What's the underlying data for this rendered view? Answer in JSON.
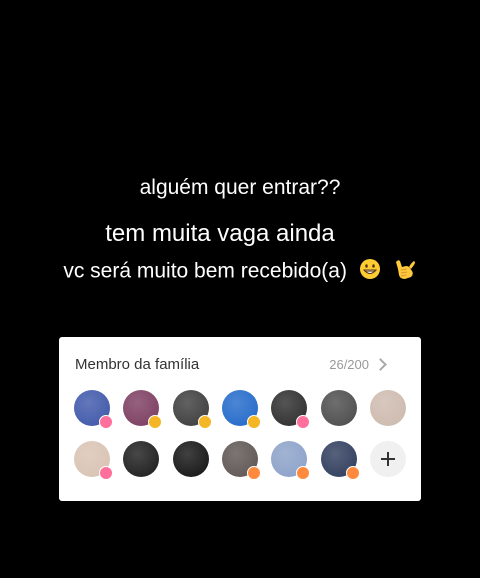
{
  "captions": {
    "line1": "alguém quer entrar??",
    "line2": "tem muita vaga ainda",
    "line3": "vc será muito bem recebido(a)",
    "emojis": [
      "grinning-face-icon",
      "call-me-hand-icon"
    ]
  },
  "family_card": {
    "title": "Membro da família",
    "count": "26/200",
    "members_row1": [
      {
        "name": "member-avatar-1",
        "color": "#3c55a8",
        "badge": "pink"
      },
      {
        "name": "member-avatar-2",
        "color": "#7a3a5e",
        "badge": "gold"
      },
      {
        "name": "member-avatar-3",
        "color": "#3a3a3a",
        "badge": "gold"
      },
      {
        "name": "member-avatar-4",
        "color": "#1f67c9",
        "badge": "gold"
      },
      {
        "name": "member-avatar-5",
        "color": "#2a2a2a",
        "badge": "pink"
      },
      {
        "name": "member-avatar-6",
        "color": "#4a4a4a",
        "badge": "none"
      },
      {
        "name": "member-avatar-7",
        "color": "#cdb9ad",
        "badge": "none"
      }
    ],
    "members_row2": [
      {
        "name": "member-avatar-8",
        "color": "#d8c2b2",
        "badge": "pink"
      },
      {
        "name": "member-avatar-9",
        "color": "#1a1a1a",
        "badge": "none"
      },
      {
        "name": "member-avatar-10",
        "color": "#111111",
        "badge": "none"
      },
      {
        "name": "member-avatar-11",
        "color": "#5b5350",
        "badge": "orange"
      },
      {
        "name": "member-avatar-12",
        "color": "#8aa0c8",
        "badge": "orange"
      },
      {
        "name": "member-avatar-13",
        "color": "#2c3a5a",
        "badge": "orange"
      }
    ],
    "add_button_icon": "plus-icon"
  }
}
